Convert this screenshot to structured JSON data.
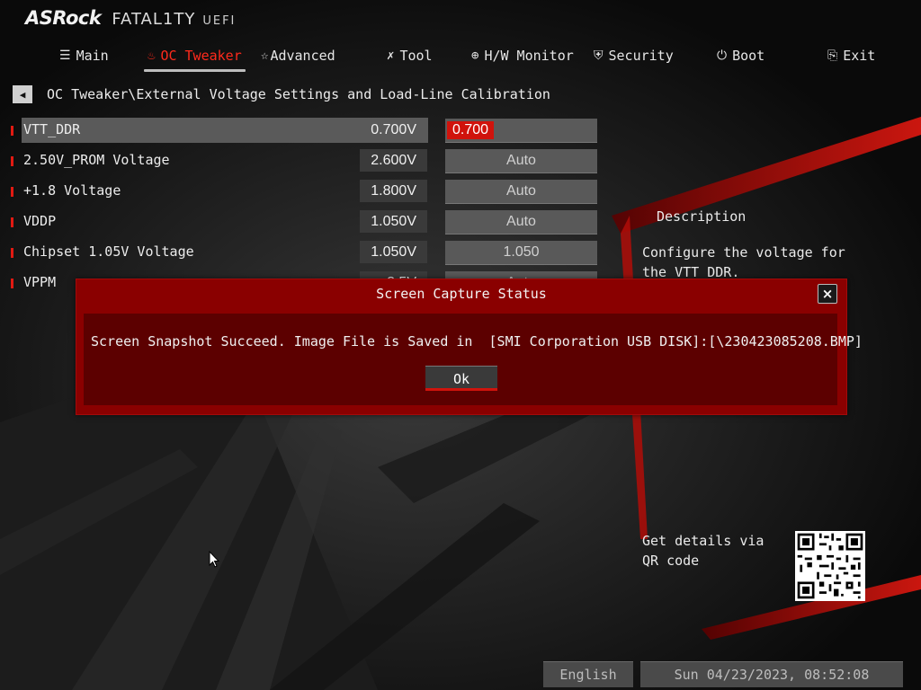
{
  "brand": {
    "name": "ASRock",
    "line": "FATAL1TY",
    "suffix": "UEFI"
  },
  "nav": {
    "items": [
      {
        "label": "Main",
        "icon": "list-icon",
        "active": false
      },
      {
        "label": "OC Tweaker",
        "icon": "flame-icon",
        "active": true
      },
      {
        "label": "Advanced",
        "icon": "star-icon",
        "active": false
      },
      {
        "label": "Tool",
        "icon": "tools-icon",
        "active": false
      },
      {
        "label": "H/W Monitor",
        "icon": "crosshair-icon",
        "active": false
      },
      {
        "label": "Security",
        "icon": "shield-icon",
        "active": false
      },
      {
        "label": "Boot",
        "icon": "power-icon",
        "active": false
      },
      {
        "label": "Exit",
        "icon": "exit-icon",
        "active": false
      }
    ]
  },
  "breadcrumb": {
    "path": "OC Tweaker\\External Voltage Settings and Load-Line Calibration"
  },
  "settings": [
    {
      "label": "VTT_DDR",
      "current": "0.700V",
      "value": "0.700",
      "editing": true
    },
    {
      "label": "2.50V_PROM Voltage",
      "current": "2.600V",
      "value": "Auto"
    },
    {
      "label": "+1.8 Voltage",
      "current": "1.800V",
      "value": "Auto"
    },
    {
      "label": "VDDP",
      "current": "1.050V",
      "value": "Auto"
    },
    {
      "label": "Chipset 1.05V Voltage",
      "current": "1.050V",
      "value": "1.050"
    },
    {
      "label": "VPPM",
      "current": "2.5V",
      "value": "Auto"
    }
  ],
  "description": {
    "title": "Description",
    "text": "Configure the voltage for the VTT_DDR."
  },
  "qr": {
    "text": "Get details via QR code"
  },
  "footer": {
    "language": "English",
    "datetime": "Sun 04/23/2023, 08:52:08"
  },
  "dialog": {
    "title": "Screen Capture Status",
    "message": "Screen Snapshot Succeed. Image File is Saved in  [SMI Corporation USB DISK]:[\\230423085208.BMP]",
    "ok_label": "Ok",
    "close_label": "×"
  },
  "colors": {
    "accent": "#d0130c",
    "dialog_bg": "#8a0000",
    "dialog_body": "#5c0000"
  }
}
